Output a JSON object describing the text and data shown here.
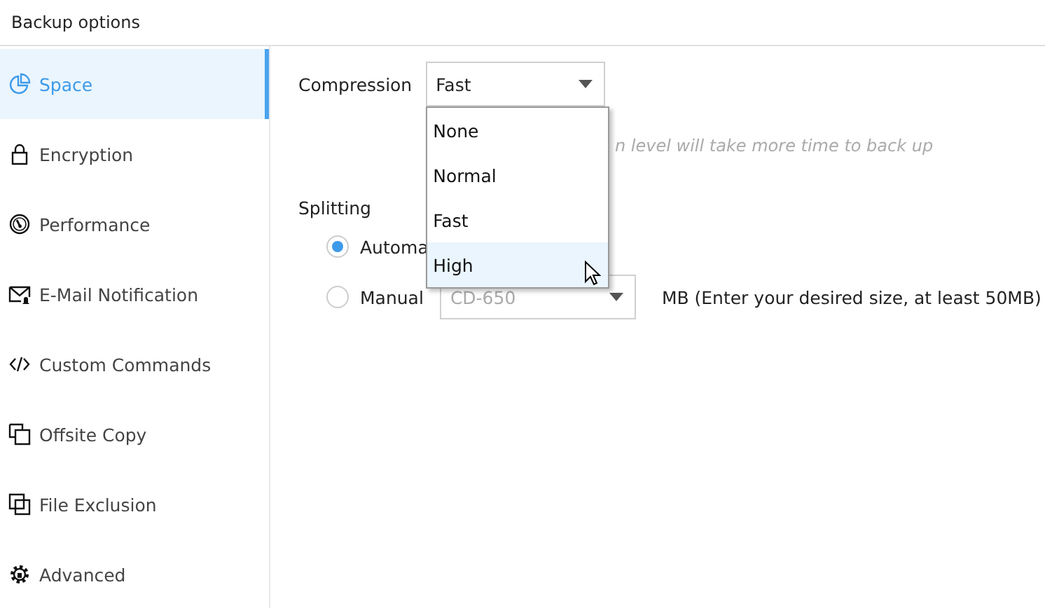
{
  "window": {
    "title": "Backup options"
  },
  "sidebar": {
    "items": [
      {
        "label": "Space",
        "selected": true
      },
      {
        "label": "Encryption",
        "selected": false
      },
      {
        "label": "Performance",
        "selected": false
      },
      {
        "label": "E-Mail Notification",
        "selected": false
      },
      {
        "label": "Custom Commands",
        "selected": false
      },
      {
        "label": "Offsite Copy",
        "selected": false
      },
      {
        "label": "File Exclusion",
        "selected": false
      },
      {
        "label": "Advanced",
        "selected": false
      }
    ]
  },
  "compression": {
    "label": "Compression",
    "value": "Fast",
    "hint": "n level will take more time to back up",
    "expanded": true,
    "options": [
      {
        "label": "None",
        "hovered": false
      },
      {
        "label": "Normal",
        "hovered": false
      },
      {
        "label": "Fast",
        "hovered": false
      },
      {
        "label": "High",
        "hovered": true
      }
    ]
  },
  "splitting": {
    "label": "Splitting",
    "options": [
      {
        "label": "Automa",
        "selected": true
      },
      {
        "label": "Manual",
        "selected": false,
        "size": {
          "value": "CD-650",
          "disabled": true
        },
        "note": "MB (Enter your desired size, at least 50MB)"
      }
    ]
  }
}
